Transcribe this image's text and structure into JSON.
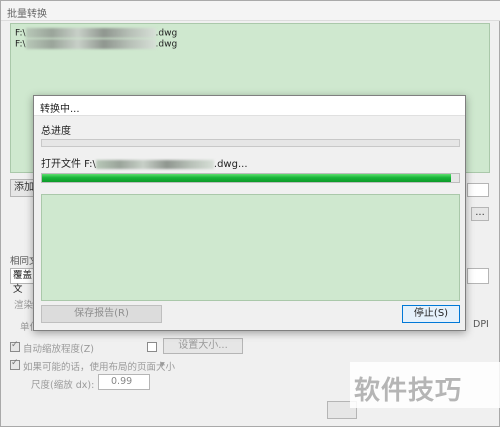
{
  "bg_window": {
    "title": "批量转换",
    "files": [
      {
        "prefix": "F:\\",
        "suffix": ".dwg"
      },
      {
        "prefix": "F:\\",
        "suffix": ".dwg"
      }
    ],
    "add_button": "添加",
    "browse_button": "...",
    "same_file_label": "相同文",
    "overwrite_select": "覆盖文",
    "hidden_row_label": "渲染",
    "unit_label": "单位",
    "dpi_label": "DPI",
    "auto_scale_label": "自动缩放程度(Z)",
    "set_size_button": "设置大小...",
    "use_layout_label": "如果可能的话，使用布局的页面大小",
    "scale_label": "尺度(缩放 dx):",
    "scale_value": "0.99"
  },
  "dialog": {
    "title": "转换中...",
    "overall_label": "总进度",
    "overall_progress": 0,
    "file_label_prefix": "打开文件 F:\\",
    "file_label_suffix": ".dwg...",
    "file_progress": 0.98,
    "save_report_button": "保存报告(R)",
    "stop_button": "停止(S)"
  },
  "watermark": "软件技巧",
  "colors": {
    "progress_green": "#19b53a",
    "list_bg": "#cfe8cf",
    "focus_blue": "#0078d7"
  }
}
